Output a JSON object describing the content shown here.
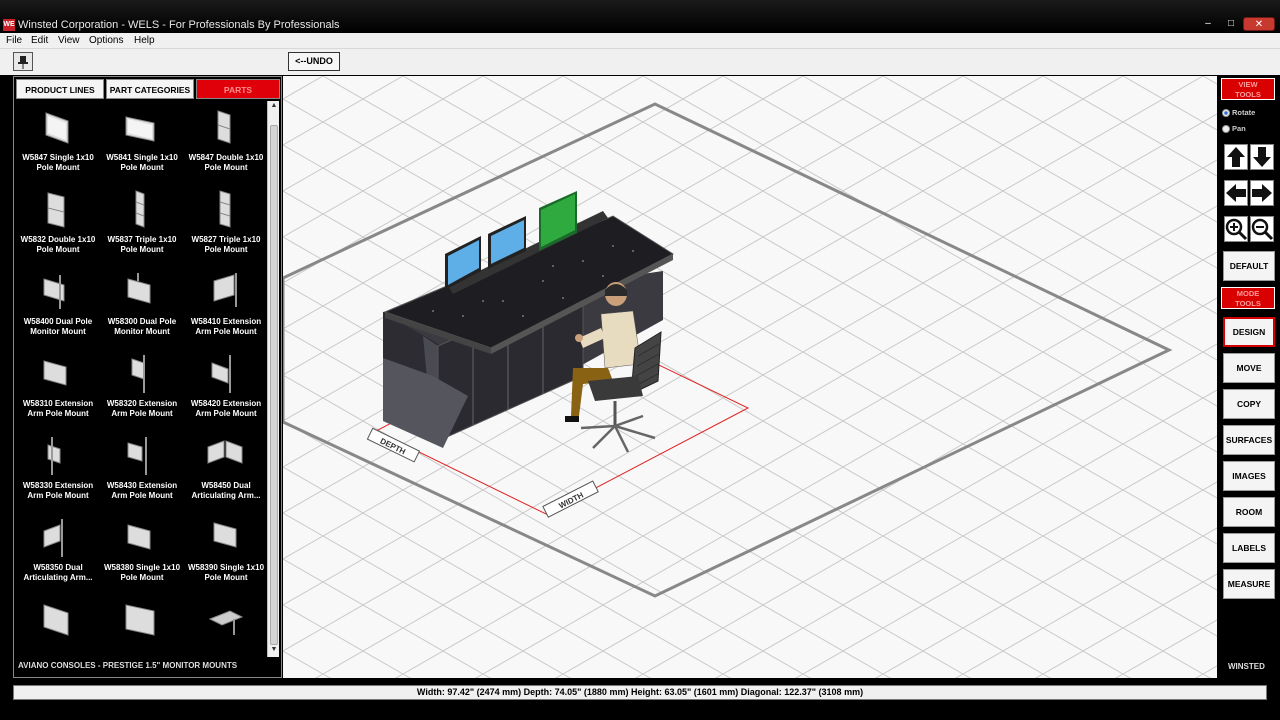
{
  "window": {
    "app_icon": "WE",
    "title": "Winsted Corporation - WELS - For Professionals By Professionals",
    "min": "–",
    "max": "□",
    "close": "✕"
  },
  "menu": [
    "File",
    "Edit",
    "View",
    "Options",
    "Help"
  ],
  "toolbar": {
    "pin": "📌",
    "undo_label": "<--UNDO"
  },
  "left_panel": {
    "tabs": [
      "PRODUCT LINES",
      "PART CATEGORIES",
      "PARTS"
    ],
    "active_tab": "PARTS",
    "parts": [
      "W5847 Single 1x10\nPole Mount",
      "W5841 Single 1x10\nPole Mount",
      "W5847 Double 1x10\nPole Mount",
      "W5832 Double 1x10\nPole Mount",
      "W5837 Triple 1x10\nPole Mount",
      "W5827 Triple 1x10\nPole Mount",
      "W58400 Dual Pole\nMonitor Mount",
      "W58300 Dual Pole\nMonitor Mount",
      "W58410 Extension\nArm Pole Mount",
      "W58310 Extension\nArm Pole Mount",
      "W58320 Extension\nArm Pole Mount",
      "W58420 Extension\nArm Pole Mount",
      "W58330 Extension\nArm Pole Mount",
      "W58430 Extension\nArm Pole Mount",
      "W58450 Dual\nArticulating Arm...",
      "W58350 Dual\nArticulating Arm...",
      "W58380 Single 1x10\nPole Mount",
      "W58390 Single 1x10\nPole Mount",
      "",
      "",
      ""
    ],
    "footer": "AVIANO CONSOLES - PRESTIGE 1.5\" MONITOR MOUNTS"
  },
  "canvas": {
    "depth_label": "DEPTH",
    "width_label": "WIDTH"
  },
  "right_panel": {
    "view_tools": "VIEW\nTOOLS",
    "rotate": "Rotate",
    "pan": "Pan",
    "default_label": "DEFAULT",
    "mode_tools": "MODE\nTOOLS",
    "modes": [
      "DESIGN",
      "MOVE",
      "COPY",
      "SURFACES",
      "IMAGES",
      "ROOM",
      "LABELS",
      "MEASURE"
    ],
    "active_mode": "DESIGN",
    "brand": "WINSTED"
  },
  "status": {
    "dimensions": "Width: 97.42\" (2474 mm)  Depth: 74.05\" (1880 mm)  Height: 63.05\" (1601 mm)  Diagonal: 122.37\" (3108 mm)"
  },
  "colors": {
    "accent_red": "#d90000",
    "close_button": "#c7392f",
    "monitor_blue": "#5eaee8",
    "monitor_green": "#2faa3f"
  }
}
